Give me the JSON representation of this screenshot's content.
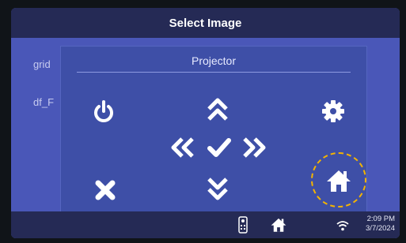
{
  "title_bar": {
    "title": "Select Image"
  },
  "background_list": {
    "items": [
      "grid",
      "df_F"
    ]
  },
  "projector_dialog": {
    "title": "Projector",
    "controls": [
      "power-icon",
      "up-icon",
      "settings-icon",
      "left-double-icon",
      "confirm-check-icon",
      "right-double-icon",
      "close-icon",
      "down-icon",
      "home-icon"
    ],
    "highlighted_control": "home-icon"
  },
  "status_bar": {
    "icons": [
      "remote-icon",
      "home-icon",
      "wifi-icon"
    ],
    "time": "2:09 PM",
    "date": "3/7/2024"
  },
  "colors": {
    "screen_bg": "#4a57b8",
    "dialog_bg": "#3e4fa7",
    "bar_bg": "#252a55",
    "icon": "#ffffff",
    "highlight": "#f4b400"
  }
}
